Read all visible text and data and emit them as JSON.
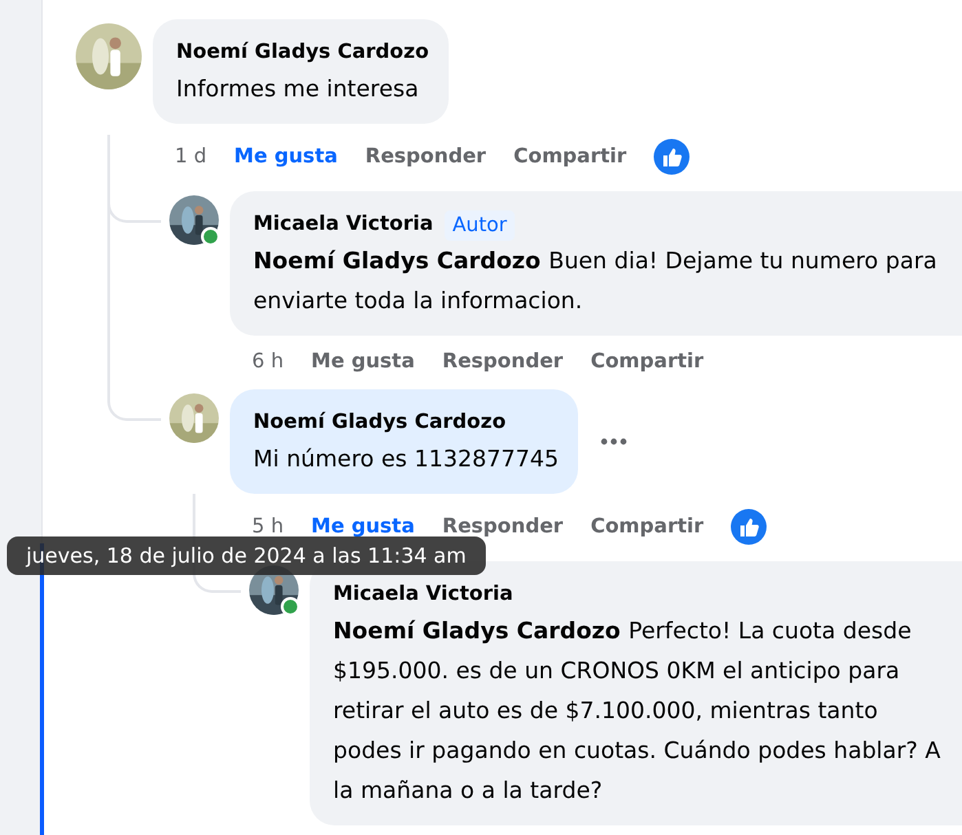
{
  "comments": [
    {
      "author": "Noemí Gladys Cardozo",
      "text": "Informes me interesa",
      "time": "1 d",
      "actions": [
        "Me gusta",
        "Responder",
        "Compartir"
      ],
      "liked": true,
      "children": [
        {
          "author": "Micaela Victoria",
          "badge": "Autor",
          "mention": "Noemí Gladys Cardozo",
          "text": "Buen dia! Dejame tu numero para enviarte toda la informacion.",
          "time": "6 h",
          "actions": [
            "Me gusta",
            "Responder",
            "Compartir"
          ],
          "liked": false,
          "online": true
        },
        {
          "author": "Noemí Gladys Cardozo",
          "text": "Mi número es 1132877745",
          "time": "5 h",
          "actions": [
            "Me gusta",
            "Responder",
            "Compartir"
          ],
          "liked": true,
          "highlighted": true,
          "menu_visible": true,
          "children": [
            {
              "author": "Micaela Victoria",
              "mention": "Noemí Gladys Cardozo",
              "text": "Perfecto! La cuota desde $195.000. es de un CRONOS 0KM el anticipo para retirar el auto es de $7.100.000, mientras tanto podes ir pagando en cuotas. Cuándo podes hablar? A la mañana o a la tarde?",
              "online": true
            }
          ]
        }
      ]
    }
  ],
  "tooltip": "jueves, 18 de julio de 2024 a las 11:34 am"
}
